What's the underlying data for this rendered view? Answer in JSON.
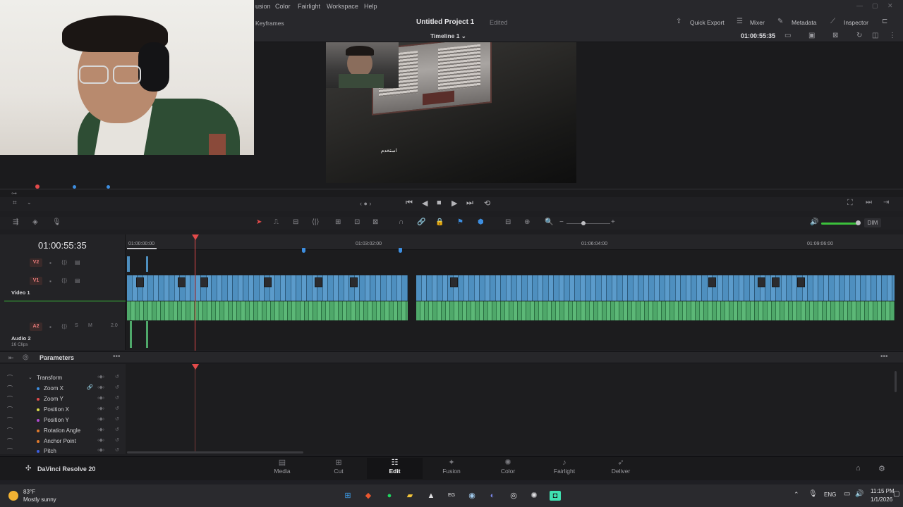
{
  "menu": {
    "items": [
      "usion",
      "Color",
      "Fairlight",
      "Workspace",
      "Help"
    ]
  },
  "header": {
    "keyframes_label": "Keyframes",
    "project_title": "Untitled Project 1",
    "project_status": "Edited",
    "timeline_name": "Timeline 1",
    "timecode": "01:00:55:35",
    "buttons": {
      "quick_export": "Quick Export",
      "mixer": "Mixer",
      "metadata": "Metadata",
      "inspector": "Inspector"
    }
  },
  "viewer": {
    "subtitle": "استخدم"
  },
  "timeline": {
    "timecode": "01:00:55:35",
    "ruler": [
      "01:00:00:00",
      "01:03:02:00",
      "01:06:04:00",
      "01:09:06:00"
    ],
    "tracks": [
      {
        "id": "V2",
        "name": ""
      },
      {
        "id": "V1",
        "name": "Video 1"
      },
      {
        "id": "A2",
        "name": "Audio 2",
        "sub": "16 Clips",
        "level": "2.0"
      }
    ],
    "audio_buttons": [
      "S",
      "M"
    ],
    "dim_label": "DIM"
  },
  "params": {
    "title": "Parameters",
    "group": "Transform",
    "rows": [
      {
        "label": "Zoom X",
        "color": "#3d8ee0"
      },
      {
        "label": "Zoom Y",
        "color": "#e04b4b"
      },
      {
        "label": "Position X",
        "color": "#d8d84a"
      },
      {
        "label": "Position Y",
        "color": "#b04ad0"
      },
      {
        "label": "Rotation Angle",
        "color": "#e07a2d"
      },
      {
        "label": "Anchor Point",
        "color": "#e07a2d"
      },
      {
        "label": "Pitch",
        "color": "#3d5ee0"
      }
    ]
  },
  "app": {
    "name": "DaVinci Resolve 20"
  },
  "pages": [
    {
      "label": "Media",
      "icon": "media-icon"
    },
    {
      "label": "Cut",
      "icon": "cut-icon"
    },
    {
      "label": "Edit",
      "icon": "edit-icon"
    },
    {
      "label": "Fusion",
      "icon": "fusion-icon"
    },
    {
      "label": "Color",
      "icon": "color-icon"
    },
    {
      "label": "Fairlight",
      "icon": "fairlight-icon"
    },
    {
      "label": "Deliver",
      "icon": "deliver-icon"
    }
  ],
  "taskbar": {
    "weather_temp": "83°F",
    "weather_desc": "Mostly sunny",
    "lang": "ENG",
    "time": "11:15 PM",
    "date": "1/1/2026"
  },
  "colors": {
    "accent_red": "#e34a4a",
    "video_clip": "#4e8fbf",
    "audio_clip": "#4fa86a",
    "marker_blue": "#3d8ee0"
  }
}
